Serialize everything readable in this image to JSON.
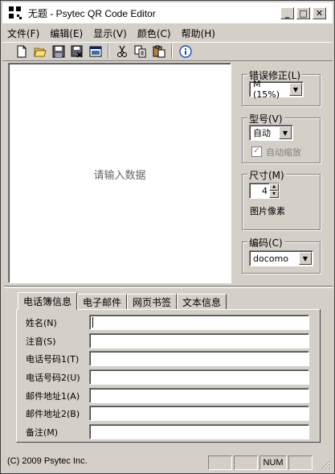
{
  "window": {
    "title": "无题 - Psytec QR Code Editor",
    "minimize": "_",
    "maximize": "□",
    "close": "✕"
  },
  "menu": [
    "文件(F)",
    "编辑(E)",
    "显示(V)",
    "颜色(C)",
    "帮助(H)"
  ],
  "toolbar": [
    "new-icon",
    "open-icon",
    "save-icon",
    "save-as-icon",
    "window-icon",
    "cut-icon",
    "copy-icon",
    "paste-icon",
    "info-icon"
  ],
  "preview": {
    "message": "请输入数据"
  },
  "error_correction": {
    "legend": "错误修正(L)",
    "value": "M (15%)"
  },
  "model": {
    "legend": "型号(V)",
    "value": "自动",
    "auto_shrink": "自动缩放",
    "auto_shrink_checked": true
  },
  "size": {
    "legend": "尺寸(M)",
    "value": "4",
    "unit_label": "图片像素"
  },
  "encoding": {
    "legend": "编码(C)",
    "value": "docomo"
  },
  "tabs": [
    "电话簿信息",
    "电子邮件",
    "网页书签",
    "文本信息"
  ],
  "fields": [
    {
      "label": "姓名(N)",
      "value": ""
    },
    {
      "label": "注音(S)",
      "value": ""
    },
    {
      "label": "电话号码1(T)",
      "value": ""
    },
    {
      "label": "电话号码2(U)",
      "value": ""
    },
    {
      "label": "邮件地址1(A)",
      "value": ""
    },
    {
      "label": "邮件地址2(B)",
      "value": ""
    },
    {
      "label": "备注(M)",
      "value": ""
    }
  ],
  "status": {
    "text": "(C) 2009 Psytec Inc.",
    "num": "NUM"
  },
  "colors": {
    "face": "#d4d0c8",
    "shadow": "#808080",
    "highlight": "#ffffff"
  }
}
